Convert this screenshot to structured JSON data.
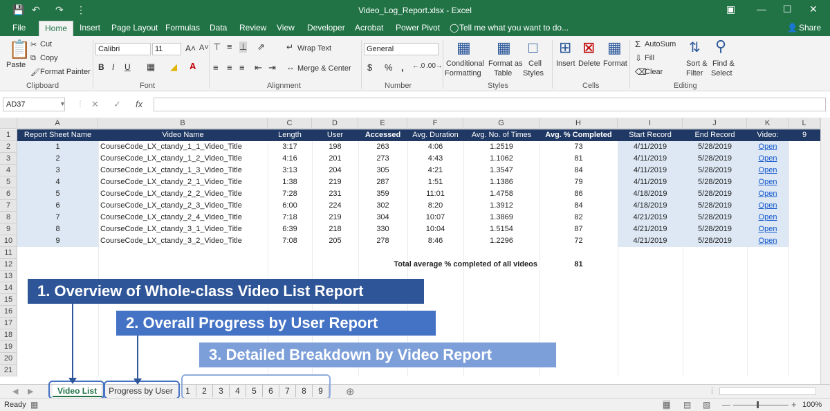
{
  "window": {
    "title": "Video_Log_Report.xlsx - Excel",
    "share_label": "Share"
  },
  "ribbon_tabs": [
    "File",
    "Home",
    "Insert",
    "Page Layout",
    "Formulas",
    "Data",
    "Review",
    "View",
    "Developer",
    "Acrobat",
    "Power Pivot"
  ],
  "tell_me": "Tell me what you want to do...",
  "ribbon": {
    "clipboard": {
      "paste": "Paste",
      "cut": "Cut",
      "copy": "Copy",
      "format_painter": "Format Painter",
      "label": "Clipboard"
    },
    "font": {
      "name": "Calibri",
      "size": "11",
      "label": "Font"
    },
    "alignment": {
      "wrap_text": "Wrap Text",
      "merge_center": "Merge & Center",
      "label": "Alignment"
    },
    "number": {
      "format": "General",
      "label": "Number"
    },
    "styles": {
      "conditional": "Conditional",
      "formatting": "Formatting",
      "format_as": "Format as",
      "table": "Table",
      "cell": "Cell",
      "cell_styles": "Styles",
      "label": "Styles"
    },
    "cells": {
      "insert": "Insert",
      "delete": "Delete",
      "format": "Format",
      "label": "Cells"
    },
    "editing": {
      "autosum": "AutoSum",
      "fill": "Fill",
      "clear": "Clear",
      "sort": "Sort &",
      "filter": "Filter",
      "find": "Find &",
      "select": "Select",
      "label": "Editing"
    }
  },
  "formula_bar": {
    "name_box": "AD37",
    "fx": "fx",
    "value": ""
  },
  "columns": [
    "A",
    "B",
    "C",
    "D",
    "E",
    "F",
    "G",
    "H",
    "I",
    "J",
    "K",
    "L"
  ],
  "rows": [
    "1",
    "2",
    "3",
    "4",
    "5",
    "6",
    "7",
    "8",
    "9",
    "10",
    "11",
    "12",
    "13",
    "14",
    "15",
    "16",
    "17",
    "18",
    "19",
    "20",
    "21"
  ],
  "header": [
    "Report Sheet Name",
    "Video Name",
    "Length",
    "User",
    "Accessed",
    "Avg. Duration",
    "Avg. No. of Times",
    "Avg. % Completed",
    "Start Record",
    "End Record",
    "Video:",
    "9"
  ],
  "table_rows": [
    [
      "1",
      "CourseCode_LX_ctandy_1_1_Video_Title",
      "3:17",
      "198",
      "263",
      "4:06",
      "1.2519",
      "73",
      "4/11/2019",
      "5/28/2019",
      "Open"
    ],
    [
      "2",
      "CourseCode_LX_ctandy_1_2_Video_Title",
      "4:16",
      "201",
      "273",
      "4:43",
      "1.1062",
      "81",
      "4/11/2019",
      "5/28/2019",
      "Open"
    ],
    [
      "3",
      "CourseCode_LX_ctandy_1_3_Video_Title",
      "3:13",
      "204",
      "305",
      "4:21",
      "1.3547",
      "84",
      "4/11/2019",
      "5/28/2019",
      "Open"
    ],
    [
      "4",
      "CourseCode_LX_ctandy_2_1_Video_Title",
      "1:38",
      "219",
      "287",
      "1:51",
      "1.1386",
      "79",
      "4/11/2019",
      "5/28/2019",
      "Open"
    ],
    [
      "5",
      "CourseCode_LX_ctandy_2_2_Video_Title",
      "7:28",
      "231",
      "359",
      "11:01",
      "1.4758",
      "86",
      "4/18/2019",
      "5/28/2019",
      "Open"
    ],
    [
      "6",
      "CourseCode_LX_ctandy_2_3_Video_Title",
      "6:00",
      "224",
      "302",
      "8:20",
      "1.3912",
      "84",
      "4/18/2019",
      "5/28/2019",
      "Open"
    ],
    [
      "7",
      "CourseCode_LX_ctandy_2_4_Video_Title",
      "7:18",
      "219",
      "304",
      "10:07",
      "1.3869",
      "82",
      "4/21/2019",
      "5/28/2019",
      "Open"
    ],
    [
      "8",
      "CourseCode_LX_ctandy_3_1_Video_Title",
      "6:39",
      "218",
      "330",
      "10:04",
      "1.5154",
      "87",
      "4/21/2019",
      "5/28/2019",
      "Open"
    ],
    [
      "9",
      "CourseCode_LX_ctandy_3_2_Video_Title",
      "7:08",
      "205",
      "278",
      "8:46",
      "1.2296",
      "72",
      "4/21/2019",
      "5/28/2019",
      "Open"
    ]
  ],
  "total": {
    "label": "Total average % completed of all videos",
    "value": "81"
  },
  "callouts": [
    "1.  Overview of Whole-class Video List Report",
    "2.  Overall Progress by User Report",
    "3.  Detailed Breakdown by Video Report"
  ],
  "sheet_tabs": [
    "Video List",
    "Progress by User",
    "1",
    "2",
    "3",
    "4",
    "5",
    "6",
    "7",
    "8",
    "9"
  ],
  "status": {
    "ready": "Ready",
    "zoom": "100%"
  },
  "colors": {
    "excel_green": "#217346",
    "header_navy": "#1f3864",
    "callout_1": "#2e5597",
    "callout_2": "#4472c4",
    "callout_3": "#7d9fd9"
  }
}
